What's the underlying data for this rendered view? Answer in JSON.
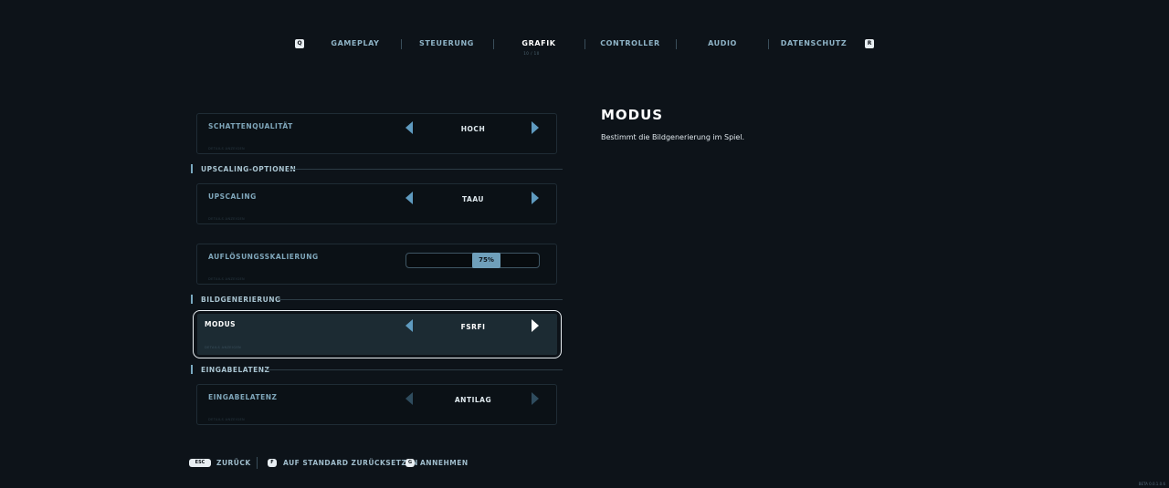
{
  "nav": {
    "prev_key": "Q",
    "next_key": "R",
    "tabs": [
      {
        "label": "GAMEPLAY",
        "active": false
      },
      {
        "label": "STEUERUNG",
        "active": false
      },
      {
        "label": "GRAFIK",
        "active": true,
        "sub": "10 / 10"
      },
      {
        "label": "CONTROLLER",
        "active": false
      },
      {
        "label": "AUDIO",
        "active": false
      },
      {
        "label": "DATENSCHUTZ",
        "active": false
      }
    ]
  },
  "settings": {
    "schattenqualitaet": {
      "label": "SCHATTENQUALITÄT",
      "value": "HOCH",
      "hint": "DETAILS ANZEIGEN"
    },
    "section_upscaling": "UPSCALING-OPTIONEN",
    "upscaling": {
      "label": "UPSCALING",
      "value": "TAAU",
      "hint": "DETAILS ANZEIGEN"
    },
    "aufloesung": {
      "label": "AUFLÖSUNGSSKALIERUNG",
      "value": "75%",
      "level_percent": 75,
      "hint": "DETAILS ANZEIGEN"
    },
    "section_bildgenerierung": "BILDGENERIERUNG",
    "modus": {
      "label": "MODUS",
      "value": "FSRFI",
      "hint": "DETAILS ANZEIGEN"
    },
    "section_eingabelatenz": "EINGABELATENZ",
    "eingabelatenz": {
      "label": "EINGABELATENZ",
      "value": "ANTILAG",
      "hint": "DETAILS ANZEIGEN"
    }
  },
  "detail": {
    "title": "MODUS",
    "description": "Bestimmt die Bildgenerierung im Spiel."
  },
  "footer": {
    "back_key": "ESC",
    "back_label": "ZURÜCK",
    "reset_key": "F",
    "reset_label": "AUF STANDARD ZURÜCKSETZEN",
    "accept_key": "G",
    "accept_label": "ANNEHMEN"
  },
  "build": "BETA 0.0.1.0.6"
}
